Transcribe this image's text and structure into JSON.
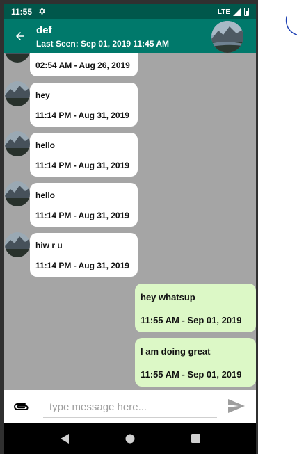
{
  "status_bar": {
    "time": "11:55",
    "network": "LTE"
  },
  "header": {
    "contact_name": "def",
    "last_seen": "Last Seen: Sep 01, 2019 11:45 AM"
  },
  "messages": [
    {
      "direction": "received",
      "text": "",
      "timestamp": "02:54 AM - Aug 26, 2019"
    },
    {
      "direction": "received",
      "text": "hey",
      "timestamp": "11:14 PM - Aug 31, 2019"
    },
    {
      "direction": "received",
      "text": "hello",
      "timestamp": "11:14 PM - Aug 31, 2019"
    },
    {
      "direction": "received",
      "text": "hello",
      "timestamp": "11:14 PM - Aug 31, 2019"
    },
    {
      "direction": "received",
      "text": "hiw r u",
      "timestamp": "11:14 PM - Aug 31, 2019"
    },
    {
      "direction": "sent",
      "text": "hey whatsup",
      "timestamp": "11:55 AM - Sep 01, 2019"
    },
    {
      "direction": "sent",
      "text": "I am doing great",
      "timestamp": "11:55 AM - Sep 01, 2019"
    }
  ],
  "composer": {
    "value": "",
    "placeholder": "type message here..."
  },
  "icons": {
    "status": "gear-icon",
    "back": "arrow-left-icon",
    "attach": "paperclip-icon",
    "send": "send-icon",
    "nav": [
      "nav-back-icon",
      "nav-home-icon",
      "nav-recents-icon"
    ]
  },
  "colors": {
    "status_bar": "#00574b",
    "app_bar": "#00796b",
    "chat_background": "#a5a5a5",
    "received_bubble": "#ffffff",
    "sent_bubble": "#dcf8c6"
  }
}
